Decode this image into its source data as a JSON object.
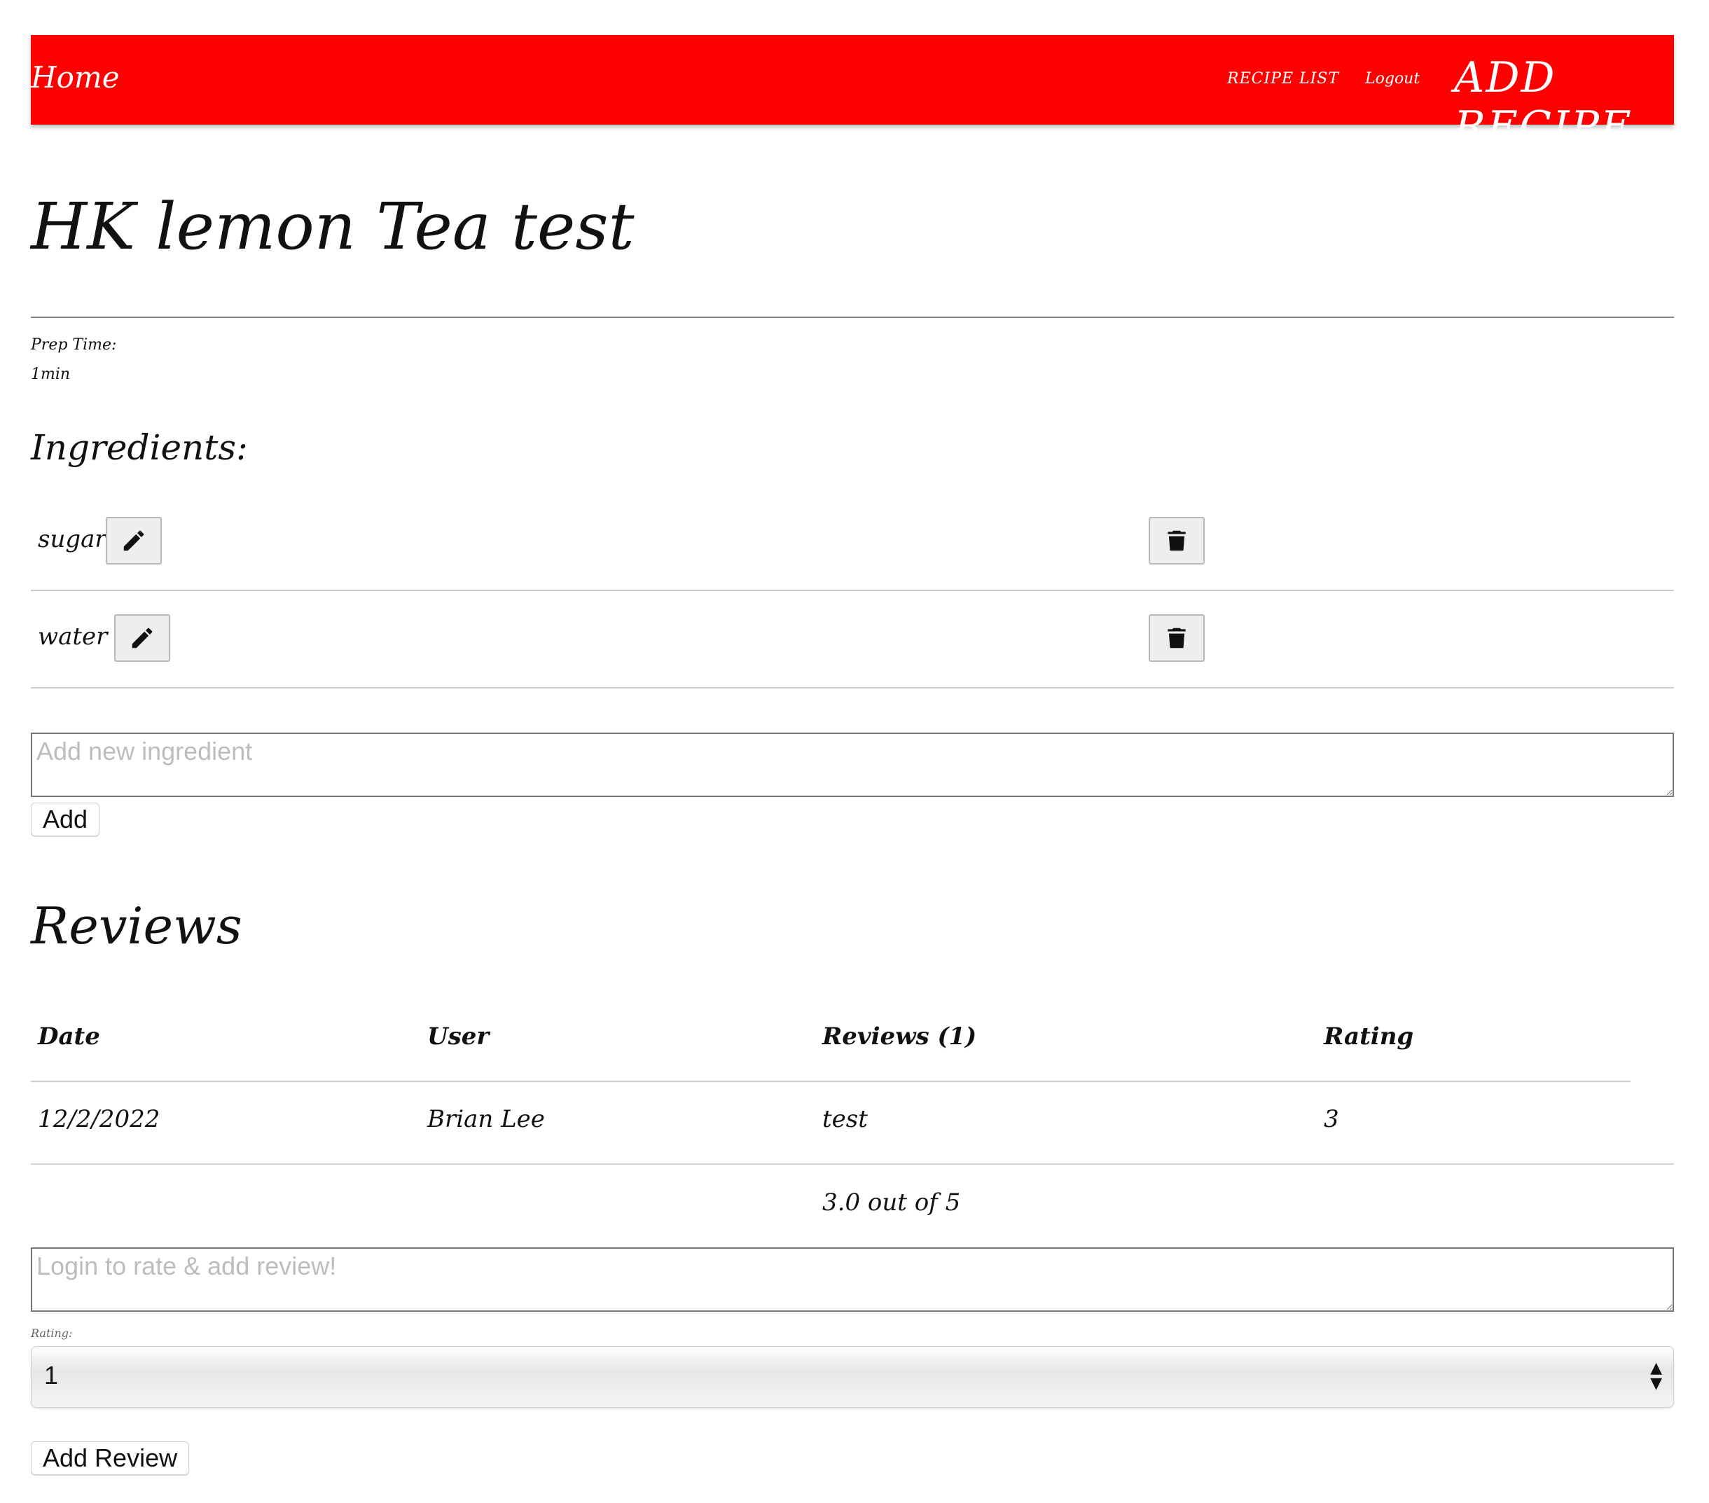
{
  "nav": {
    "home": "Home",
    "recipe_list": "RECIPE LIST",
    "logout": "Logout",
    "add_recipe": "ADD RECIPE"
  },
  "recipe": {
    "title": "HK lemon Tea test",
    "prep_label": "Prep Time:",
    "prep_value": "1min"
  },
  "ingredients": {
    "heading": "Ingredients:",
    "items": [
      {
        "name": "sugar"
      },
      {
        "name": "water"
      }
    ],
    "input_placeholder": "Add new ingredient",
    "add_label": "Add"
  },
  "reviews": {
    "heading": "Reviews",
    "columns": [
      "Date",
      "User",
      "Reviews (1)",
      "Rating"
    ],
    "rows": [
      {
        "date": "12/2/2022",
        "user": "Brian Lee",
        "review": "test",
        "rating": "3"
      }
    ],
    "average": "3.0 out of 5",
    "input_placeholder": "Login to rate & add review!",
    "rating_label": "Rating:",
    "rating_selected": "1",
    "add_review_label": "Add Review"
  },
  "colors": {
    "navbar": "#ff0000"
  },
  "icons": {
    "edit": "pencil-icon",
    "delete": "trash-icon",
    "select": "select-arrows-icon"
  }
}
